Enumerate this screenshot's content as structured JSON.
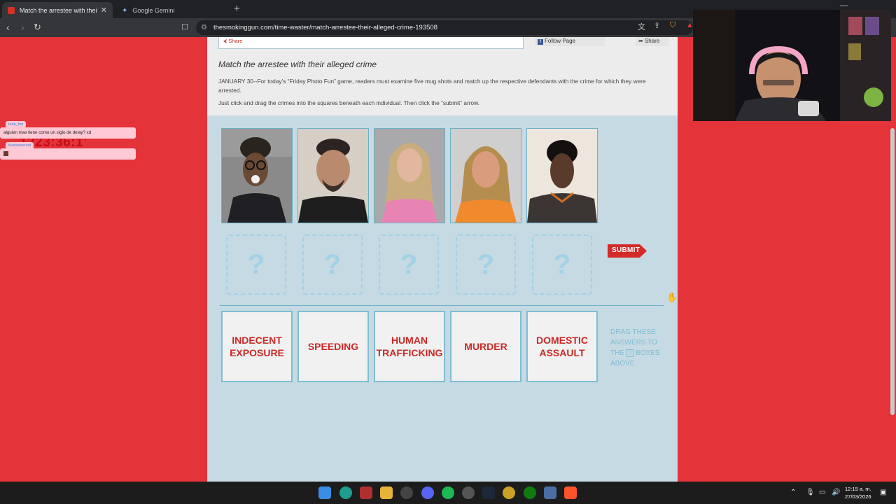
{
  "browser": {
    "tabs": [
      {
        "title": "Match the arrestee with their alleged crime",
        "active": true
      },
      {
        "title": "Google Gemini",
        "active": false
      }
    ],
    "url": "thesmokinggun.com/time-waster/match-arrestee-their-alleged-crime-193508"
  },
  "article": {
    "share_label": "Share",
    "follow_label": "Follow Page",
    "share2_label": "Share",
    "title": "Match the arrestee with their alleged crime",
    "intro": "JANUARY 30--For today’s “Friday Photo Fun” game, readers must examine five mug shots and match up the respective defendants with the crime for which they were arrested.",
    "instructions": "Just click and drag the crimes into the squares beneath each individual. Then click the “submit” arrow."
  },
  "game": {
    "mugshots": [
      "Mugshot 1",
      "Mugshot 2",
      "Mugshot 3",
      "Mugshot 4",
      "Mugshot 5"
    ],
    "drop_placeholder": "?",
    "submit_label": "SUBMIT",
    "answers": [
      "INDECENT EXPOSURE",
      "SPEEDING",
      "HUMAN TRAFFICKING",
      "MURDER",
      "DOMESTIC ASSAULT"
    ],
    "instruction_prefix": "DRAG THESE ANSWERS TO THE",
    "instruction_box": "?",
    "instruction_suffix": "BOXES ABOVE"
  },
  "overlay": {
    "timer": "1223:36:1’",
    "chat_user1": "funk_bot",
    "chat_msg1": "alguien mas tiene como un siglo de delay? xd",
    "chat_user2": "luanezescool"
  },
  "taskbar": {
    "time": "12:15 a. m.",
    "date": "27/03/2026"
  },
  "colors": {
    "page_bg": "#e5333a",
    "article_bg": "#c5dae3",
    "accent_red": "#cc2927",
    "box_blue": "#7fbdd2"
  }
}
